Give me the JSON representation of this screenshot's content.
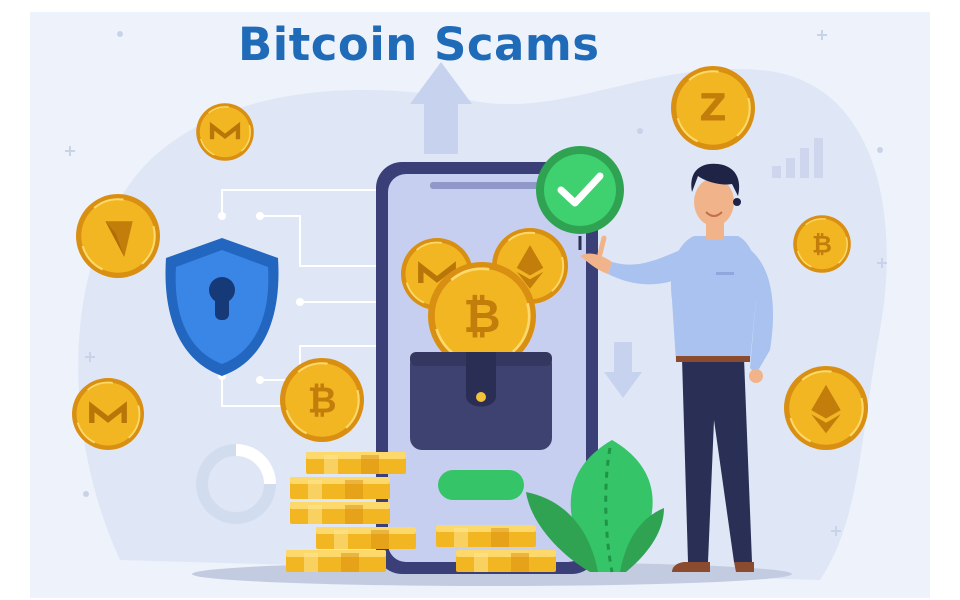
{
  "title": "Bitcoin Scams",
  "colors": {
    "title": "#1f6bb8",
    "coin_gold": "#f2b623",
    "coin_dark": "#d98f12",
    "shield": "#3a86e6",
    "check_green": "#2fbd5c",
    "phone_frame": "#3a3f78",
    "wallet": "#3d4270",
    "shirt": "#a9c2f0",
    "trousers": "#2a2f55",
    "plant": "#36c468",
    "background_blob": "#dfe7f6"
  },
  "icons": {
    "coins": [
      "monero-coin-icon",
      "ethereum-coin-icon",
      "bitcoin-coin-icon",
      "zcash-coin-icon"
    ],
    "shield": "shield-lock-icon",
    "check": "checkmark-icon",
    "arrows": [
      "arrow-up-icon",
      "arrow-down-icon"
    ],
    "bars": "bar-chart-icon"
  }
}
